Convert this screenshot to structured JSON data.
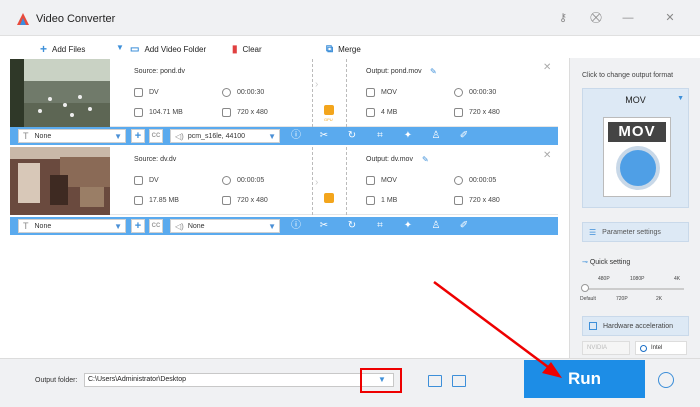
{
  "app": {
    "title": "Video Converter"
  },
  "toolbar": {
    "add_files": "Add Files",
    "add_video_folder": "Add Video Folder",
    "clear": "Clear",
    "merge": "Merge"
  },
  "files": [
    {
      "source_label": "Source: pond.dv",
      "src_format": "DV",
      "src_duration": "00:00:30",
      "src_size": "104.71 MB",
      "src_resolution": "720 x 480",
      "output_label": "Output: pond.mov",
      "out_format": "MOV",
      "out_duration": "00:00:30",
      "out_size": "4 MB",
      "out_resolution": "720 x 480",
      "subtitle": "None",
      "audio": "pcm_s16le, 44100"
    },
    {
      "source_label": "Source: dv.dv",
      "src_format": "DV",
      "src_duration": "00:00:05",
      "src_size": "17.85 MB",
      "src_resolution": "720 x 480",
      "output_label": "Output: dv.mov",
      "out_format": "MOV",
      "out_duration": "00:00:05",
      "out_size": "1 MB",
      "out_resolution": "720 x 480",
      "subtitle": "None",
      "audio": "None"
    }
  ],
  "gpu_label": "GPU",
  "right_panel": {
    "hint": "Click to change output format",
    "format": "MOV",
    "format_icon_text": "MOV",
    "parameter_settings": "Parameter settings",
    "quick_setting": "Quick setting",
    "ticks_top": [
      "480P",
      "1080P",
      "4K"
    ],
    "ticks_bottom": [
      "Default",
      "720P",
      "2K"
    ],
    "hardware_acceleration": "Hardware acceleration",
    "nvidia": "NVIDIA",
    "intel": "Intel"
  },
  "bottom": {
    "output_folder_label": "Output folder:",
    "output_path": "C:\\Users\\Administrator\\Desktop",
    "run": "Run"
  },
  "colors": {
    "accent": "#1d8de6",
    "bar": "#5aaaee",
    "highlight": "#e00000"
  }
}
